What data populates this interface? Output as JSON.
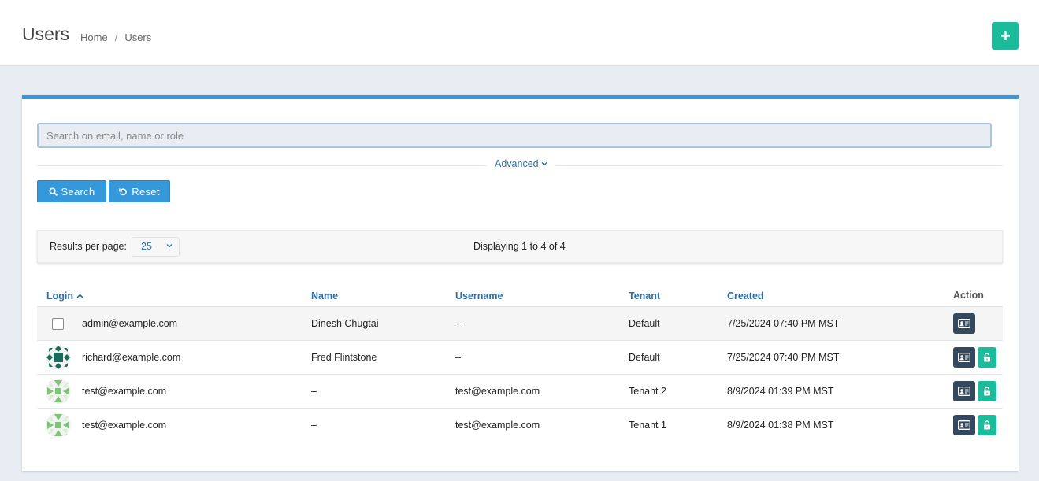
{
  "header": {
    "title": "Users",
    "breadcrumb": [
      "Home",
      "Users"
    ],
    "add_icon": "plus-icon",
    "accent": "#1abc9c"
  },
  "search": {
    "placeholder": "Search on email, name or role",
    "value": "",
    "advanced_label": "Advanced",
    "search_label": "Search",
    "reset_label": "Reset"
  },
  "results": {
    "per_page_label": "Results per page:",
    "per_page_value": "25",
    "displaying": "Displaying 1 to 4 of 4"
  },
  "table": {
    "columns": {
      "login": "Login",
      "name": "Name",
      "username": "Username",
      "tenant": "Tenant",
      "created": "Created",
      "action": "Action"
    },
    "rows": [
      {
        "login": "admin@example.com",
        "name": "Dinesh Chugtai",
        "username": "–",
        "tenant": "Default",
        "created": "7/25/2024 07:40 PM MST"
      },
      {
        "login": "richard@example.com",
        "name": "Fred Flintstone",
        "username": "–",
        "tenant": "Default",
        "created": "7/25/2024 07:40 PM MST"
      },
      {
        "login": "test@example.com",
        "name": "–",
        "username": "test@example.com",
        "tenant": "Tenant 2",
        "created": "8/9/2024 01:39 PM MST"
      },
      {
        "login": "test@example.com",
        "name": "–",
        "username": "test@example.com",
        "tenant": "Tenant 1",
        "created": "8/9/2024 01:38 PM MST"
      }
    ]
  },
  "colors": {
    "primary": "#3498db",
    "success": "#1abc9c",
    "dark": "#34495e",
    "link": "#2a6fa8"
  }
}
